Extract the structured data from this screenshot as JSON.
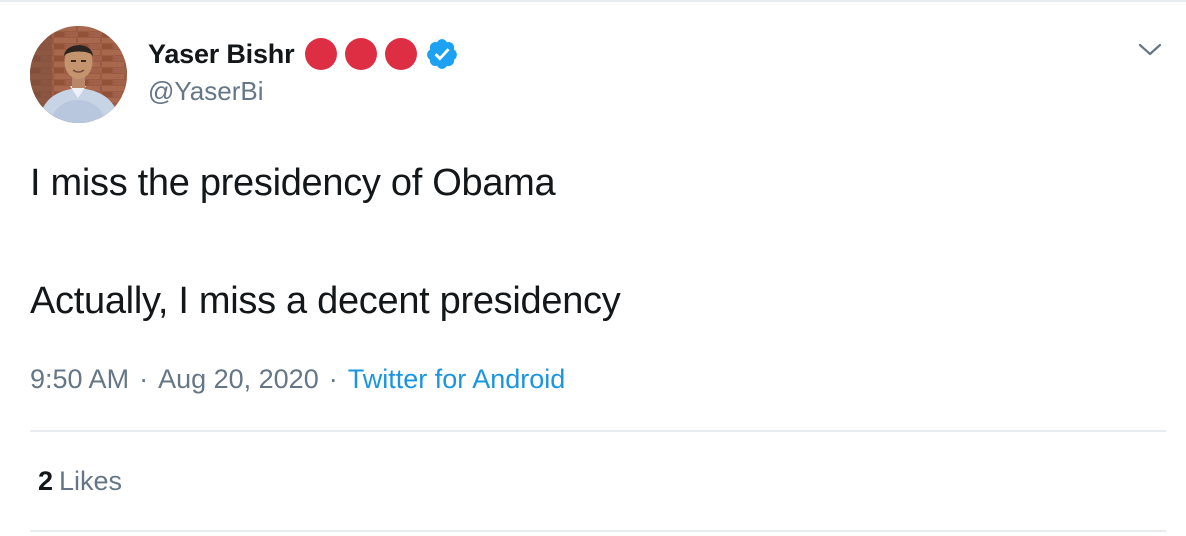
{
  "tweet": {
    "author": {
      "display_name": "Yaser Bishr",
      "handle": "@YaserBi",
      "avatar_icon": "profile-photo",
      "emoji_icons": [
        "red-circle-emoji",
        "red-circle-emoji",
        "red-circle-emoji"
      ],
      "verified_icon": "verified-badge-icon"
    },
    "text_lines": [
      "I miss the presidency of Obama",
      "Actually, I miss a decent presidency"
    ],
    "time": "9:50 AM",
    "separator": "·",
    "date": "Aug 20, 2020",
    "source": "Twitter for Android",
    "likes": {
      "count": "2",
      "label": "Likes"
    },
    "menu_icon": "chevron-down-icon"
  },
  "colors": {
    "text": "#14171a",
    "secondary": "#657786",
    "link": "#1b95e0",
    "verified": "#1da1f2",
    "emoji_red": "#dd2e44",
    "divider": "#e6ecf0"
  }
}
